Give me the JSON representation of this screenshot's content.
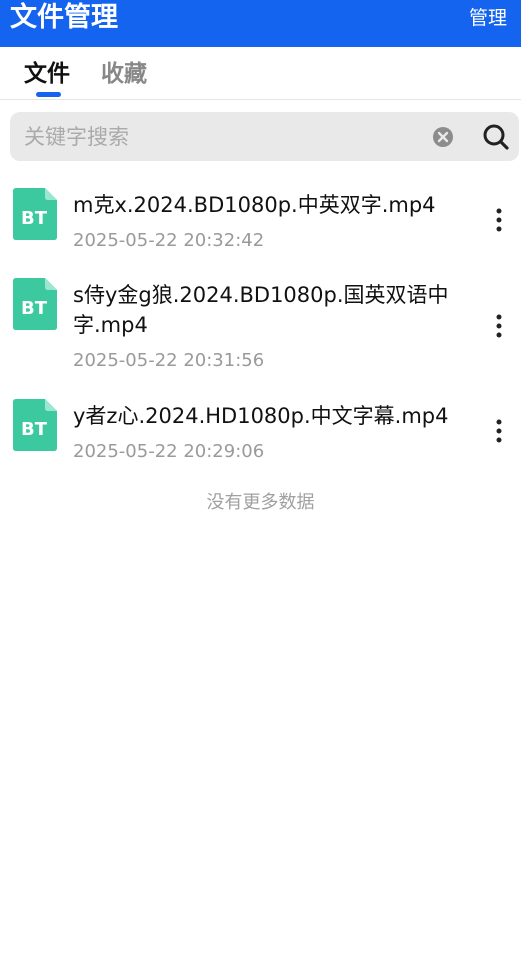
{
  "header": {
    "title": "文件管理",
    "action_label": "管理",
    "bg_color": "#1464f0"
  },
  "tabs": [
    {
      "label": "文件",
      "active": true
    },
    {
      "label": "收藏",
      "active": false
    }
  ],
  "search": {
    "placeholder": "关键字搜索",
    "value": ""
  },
  "files": [
    {
      "icon": "bt-file-icon",
      "badge": "BT",
      "name": "m克x.2024.BD1080p.中英双字.mp4",
      "time": "2025-05-22 20:32:42"
    },
    {
      "icon": "bt-file-icon",
      "badge": "BT",
      "name": "s侍y金g狼.2024.BD1080p.国英双语中字.mp4",
      "time": "2025-05-22 20:31:56"
    },
    {
      "icon": "bt-file-icon",
      "badge": "BT",
      "name": "y者z心.2024.HD1080p.中文字幕.mp4",
      "time": "2025-05-22 20:29:06"
    }
  ],
  "list_end_text": "没有更多数据",
  "colors": {
    "accent": "#1464f0",
    "bt_icon": "#3dc9a0"
  }
}
